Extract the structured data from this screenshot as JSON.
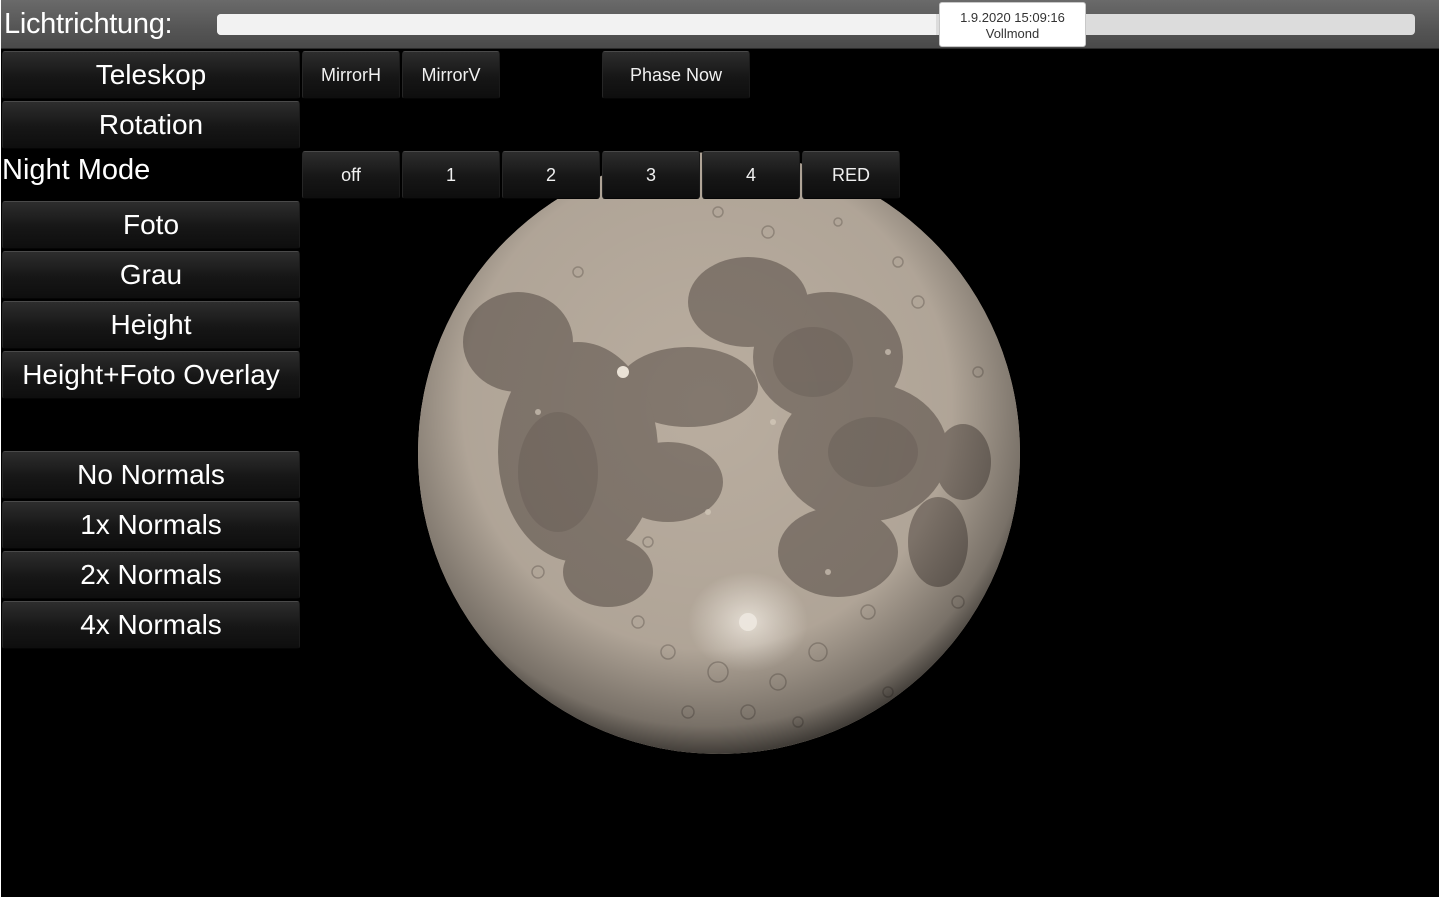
{
  "topbar": {
    "label": "Lichtrichtung:",
    "slider": {
      "value": 0.6,
      "date": "1.9.2020 15:09:16",
      "phase": "Vollmond"
    }
  },
  "toolbar": {
    "mirror_h": "MirrorH",
    "mirror_v": "MirrorV",
    "phase_now": "Phase Now"
  },
  "night_mode": {
    "label": "Night Mode",
    "options": [
      "off",
      "1",
      "2",
      "3",
      "4",
      "RED"
    ]
  },
  "sidebar": {
    "view": [
      "Teleskop",
      "Rotation"
    ],
    "textures": [
      "Foto",
      "Grau",
      "Height",
      "Height+Foto Overlay"
    ],
    "normals": [
      "No Normals",
      "1x Normals",
      "2x Normals",
      "4x Normals"
    ]
  },
  "colors": {
    "background": "#000000",
    "button": "#1a1a1a",
    "topbar": "#5a5a5a",
    "moon_highland": "#b5a89a",
    "moon_mare": "#7d7168"
  },
  "icons": {
    "moon": "full-moon-render"
  }
}
